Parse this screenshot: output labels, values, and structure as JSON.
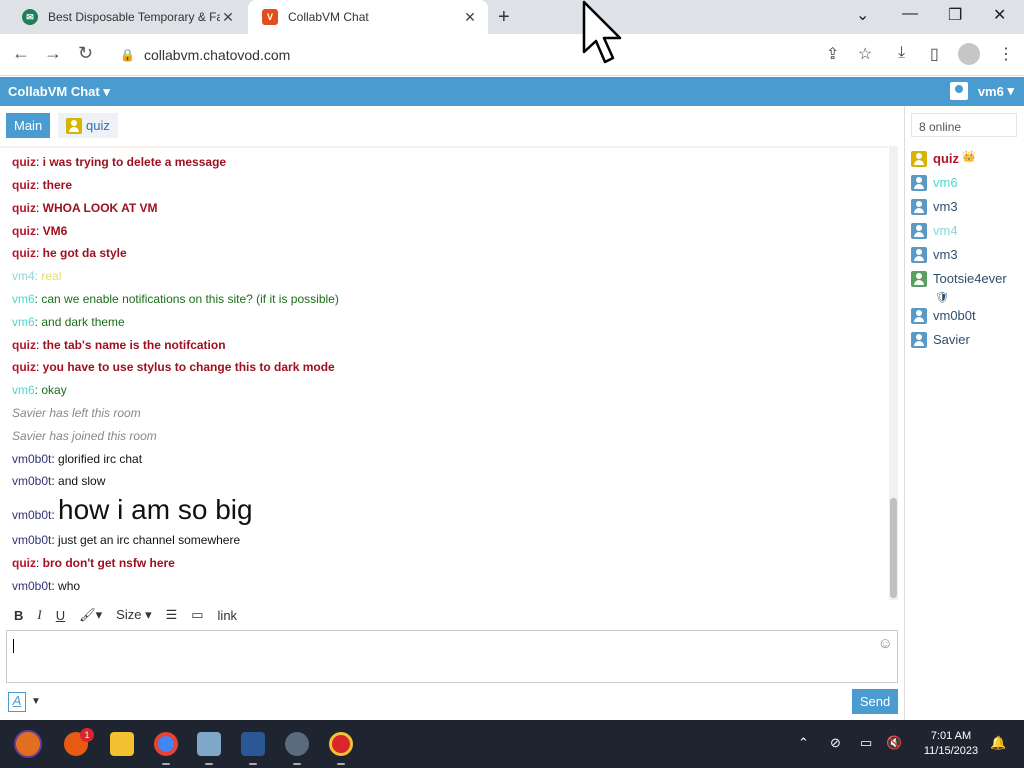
{
  "browser": {
    "tabs": [
      {
        "title": "Best Disposable Temporary & Fa",
        "active": false
      },
      {
        "title": "CollabVM Chat",
        "active": true
      }
    ],
    "url": "collabvm.chatovod.com",
    "new_tab_glyph": "+",
    "window_controls": [
      "chevron-down",
      "minimize",
      "restore",
      "close"
    ]
  },
  "app": {
    "title": "CollabVM Chat",
    "user": "vm6",
    "accent_color": "#4a9bd0"
  },
  "rooms": [
    {
      "label": "Main",
      "active": true
    },
    {
      "label": "quiz",
      "active": false
    }
  ],
  "messages": [
    {
      "nick": "quiz",
      "sep": ": ",
      "text": "i was trying to delete a message",
      "style": "quiz"
    },
    {
      "nick": "quiz",
      "sep": ": ",
      "text": "there",
      "style": "quiz"
    },
    {
      "nick": "quiz",
      "sep": ": ",
      "text": "WHOA LOOK AT VM",
      "style": "quiz"
    },
    {
      "nick": "quiz",
      "sep": ": ",
      "text": "VM6",
      "style": "quiz"
    },
    {
      "nick": "quiz",
      "sep": ": ",
      "text": "he got da style",
      "style": "quiz"
    },
    {
      "nick": "vm4",
      "sep": ": ",
      "text": "real",
      "style": "vm4"
    },
    {
      "nick": "vm6",
      "sep": ": ",
      "text": "can we enable notifications on this site? (if it is possible)",
      "style": "vm6"
    },
    {
      "nick": "vm6",
      "sep": ": ",
      "text": "and dark theme",
      "style": "vm6"
    },
    {
      "nick": "quiz",
      "sep": ": ",
      "text": "the tab's name is the notifcation",
      "style": "quiz"
    },
    {
      "nick": "quiz",
      "sep": ": ",
      "text": "you have to use stylus to change this to dark mode",
      "style": "quiz"
    },
    {
      "nick": "vm6",
      "sep": ": ",
      "text": "okay",
      "style": "vm6"
    },
    {
      "nick": "",
      "sep": "",
      "text": "Savier has left this room",
      "style": "sys"
    },
    {
      "nick": "",
      "sep": "",
      "text": "Savier has joined this room",
      "style": "sys"
    },
    {
      "nick": "vm0b0t",
      "sep": ": ",
      "text": "glorified irc chat",
      "style": "vm0"
    },
    {
      "nick": "vm0b0t",
      "sep": ": ",
      "text": "and slow",
      "style": "vm0"
    },
    {
      "nick": "vm0b0t",
      "sep": ": ",
      "text": "how i am so big",
      "style": "vm0big"
    },
    {
      "nick": "vm0b0t",
      "sep": ": ",
      "text": "just get an irc channel somewhere",
      "style": "vm0"
    },
    {
      "nick": "quiz",
      "sep": ": ",
      "text": "bro don't get nsfw here",
      "style": "quiz"
    },
    {
      "nick": "vm0b0t",
      "sep": ": ",
      "text": "who",
      "style": "vm0"
    }
  ],
  "editor": {
    "bold": "B",
    "italic": "I",
    "underline": "U",
    "size_label": "Size",
    "link_label": "link",
    "font_button": "A",
    "send_label": "Send"
  },
  "sidebar": {
    "online_label": "8 online",
    "users": [
      {
        "name": "quiz",
        "style": "quiz",
        "badge": "crown-icon"
      },
      {
        "name": "vm6",
        "style": "vm6"
      },
      {
        "name": "vm3",
        "style": "normal"
      },
      {
        "name": "vm4",
        "style": "vm4"
      },
      {
        "name": "vm3",
        "style": "normal"
      },
      {
        "name": "Tootsie4ever",
        "style": "normal",
        "badge": "shield-icon"
      },
      {
        "name": "vm0b0t",
        "style": "normal"
      },
      {
        "name": "Savier",
        "style": "normal"
      }
    ]
  },
  "taskbar": {
    "time": "7:01 AM",
    "date": "11/15/2023",
    "notification_count": "1"
  }
}
